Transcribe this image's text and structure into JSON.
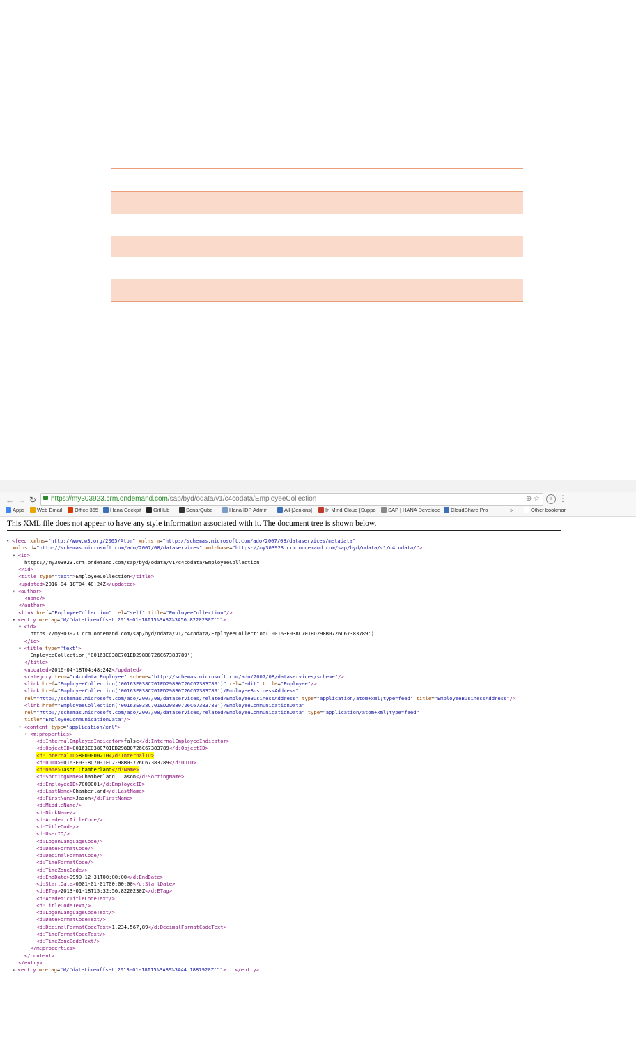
{
  "browser": {
    "url_domain": "https://my303923.crm.ondemand.com",
    "url_path": "/sap/byd/odata/v1/c4codata/EmployeeCollection",
    "bookmarks": [
      "Apps",
      "Web Email",
      "Office 365",
      "Hana Cockpit",
      "GitHub",
      "SonarQube",
      "Hana IDP Admin",
      "All [Jenkins]",
      "In Mind Cloud (Suppo",
      "SAP | HANA Develope",
      "CloudShare Pro",
      "»",
      "Other bookmar"
    ],
    "bookmark_colors": [
      "#4285f4",
      "#e8a600",
      "#d83b01",
      "#3b6fb6",
      "#222222",
      "#333333",
      "#7a9cc6",
      "#3b6fb6",
      "#c0392b",
      "#888888",
      "#3b6fb6",
      "#e8a600",
      "#ffffff",
      "#e0c070"
    ]
  },
  "notice": "This XML file does not appear to have any style information associated with it. The document tree is shown below.",
  "xml_lines": [
    "<span class='tri'>▾</span><span class='t'>&lt;feed</span> <span class='a'>xmlns</span>=<span class='v'>\"http://www.w3.org/2005/Atom\"</span> <span class='a'>xmlns:m</span>=<span class='v'>\"http://schemas.microsoft.com/ado/2007/08/dataservices/metadata\"</span>",
    "  <span class='a'>xmlns:d</span>=<span class='v'>\"http://schemas.microsoft.com/ado/2007/08/dataservices\"</span> <span class='a'>xml:base</span>=<span class='v'>\"https://my303923.crm.ondemand.com/sap/byd/odata/v1/c4codata/\"</span><span class='t'>&gt;</span>",
    "  <span class='tri'>▾</span><span class='t'>&lt;id&gt;</span>",
    "      https://my303923.crm.ondemand.com/sap/byd/odata/v1/c4codata/EmployeeCollection",
    "    <span class='t'>&lt;/id&gt;</span>",
    "    <span class='t'>&lt;title</span> <span class='a'>type</span>=<span class='v'>\"text\"</span><span class='t'>&gt;</span>EmployeeCollection<span class='t'>&lt;/title&gt;</span>",
    "    <span class='t'>&lt;updated&gt;</span>2016-04-18T04:48:24Z<span class='t'>&lt;/updated&gt;</span>",
    "  <span class='tri'>▾</span><span class='t'>&lt;author&gt;</span>",
    "      <span class='t'>&lt;name/&gt;</span>",
    "    <span class='t'>&lt;/author&gt;</span>",
    "    <span class='t'>&lt;link</span> <span class='a'>href</span>=<span class='v'>\"EmployeeCollection\"</span> <span class='a'>rel</span>=<span class='v'>\"self\"</span> <span class='a'>title</span>=<span class='v'>\"EmployeeCollection\"</span><span class='t'>/&gt;</span>",
    "  <span class='tri'>▾</span><span class='t'>&lt;entry</span> <span class='a'>m:etag</span>=<span class='v'>\"W/\"datetimeoffset'2013-01-18T15%3A32%3A56.8220230Z'\"\"</span><span class='t'>&gt;</span>",
    "    <span class='tri'>▾</span><span class='t'>&lt;id&gt;</span>",
    "        https://my303923.crm.ondemand.com/sap/byd/odata/v1/c4codata/EmployeeCollection('00163E038C701ED298B0726C67383789')",
    "      <span class='t'>&lt;/id&gt;</span>",
    "    <span class='tri'>▾</span><span class='t'>&lt;title</span> <span class='a'>type</span>=<span class='v'>\"text\"</span><span class='t'>&gt;</span>",
    "        EmployeeCollection('00163E038C701ED298B0726C67383789')",
    "      <span class='t'>&lt;/title&gt;</span>",
    "      <span class='t'>&lt;updated&gt;</span>2016-04-18T04:48:24Z<span class='t'>&lt;/updated&gt;</span>",
    "      <span class='t'>&lt;category</span> <span class='a'>term</span>=<span class='v'>\"c4codata.Employee\"</span> <span class='a'>scheme</span>=<span class='v'>\"http://schemas.microsoft.com/ado/2007/08/dataservices/scheme\"</span><span class='t'>/&gt;</span>",
    "      <span class='t'>&lt;link</span> <span class='a'>href</span>=<span class='v'>\"EmployeeCollection('00163E038C701ED298B0726C67383789')\"</span> <span class='a'>rel</span>=<span class='v'>\"edit\"</span> <span class='a'>title</span>=<span class='v'>\"Employee\"</span><span class='t'>/&gt;</span>",
    "      <span class='t'>&lt;link</span> <span class='a'>href</span>=<span class='v'>\"EmployeeCollection('00163E038C701ED298B0726C67383789')/EmployeeBusinessAddress\"</span>",
    "      <span class='a'>rel</span>=<span class='v'>\"http://schemas.microsoft.com/ado/2007/08/dataservices/related/EmployeeBusinessAddress\"</span> <span class='a'>type</span>=<span class='v'>\"application/atom+xml;type=feed\"</span> <span class='a'>title</span>=<span class='v'>\"EmployeeBusinessAddress\"</span><span class='t'>/&gt;</span>",
    "      <span class='t'>&lt;link</span> <span class='a'>href</span>=<span class='v'>\"EmployeeCollection('00163E038C701ED298B0726C67383789')/EmployeeCommunicationData\"</span>",
    "      <span class='a'>rel</span>=<span class='v'>\"http://schemas.microsoft.com/ado/2007/08/dataservices/related/EmployeeCommunicationData\"</span> <span class='a'>type</span>=<span class='v'>\"application/atom+xml;type=feed\"</span>",
    "      <span class='a'>title</span>=<span class='v'>\"EmployeeCommunicationData\"</span><span class='t'>/&gt;</span>",
    "    <span class='tri'>▾</span><span class='t'>&lt;content</span> <span class='a'>type</span>=<span class='v'>\"application/xml\"</span><span class='t'>&gt;</span>",
    "      <span class='tri'>▾</span><span class='t'>&lt;m:properties&gt;</span>",
    "          <span class='t'>&lt;d:InternalEmployeeIndicator&gt;</span>false<span class='t'>&lt;/d:InternalEmployeeIndicator&gt;</span>",
    "          <span class='t'>&lt;d:ObjectID&gt;</span>00163E038C701ED298B0726C67383789<span class='t'>&lt;/d:ObjectID&gt;</span>",
    "          <span class='hl'><span class='t'>&lt;d:InternalID&gt;</span>8000000210<span class='t'>&lt;/d:InternalID&gt;</span></span>",
    "          <span class='t'>&lt;d:UUID&gt;</span>00163E03-8C70-1ED2-98B0-726C67383789<span class='t'>&lt;/d:UUID&gt;</span>",
    "          <span class='hl'><span class='t'>&lt;d:Name&gt;</span>Jason Chamberland<span class='t'>&lt;/d:Name&gt;</span></span>",
    "          <span class='t'>&lt;d:SortingName&gt;</span>Chamberland, Jason<span class='t'>&lt;/d:SortingName&gt;</span>",
    "          <span class='t'>&lt;d:EmployeeID&gt;</span>7000001<span class='t'>&lt;/d:EmployeeID&gt;</span>",
    "          <span class='t'>&lt;d:LastName&gt;</span>Chamberland<span class='t'>&lt;/d:LastName&gt;</span>",
    "          <span class='t'>&lt;d:FirstName&gt;</span>Jason<span class='t'>&lt;/d:FirstName&gt;</span>",
    "          <span class='t'>&lt;d:MiddleName/&gt;</span>",
    "          <span class='t'>&lt;d:NickName/&gt;</span>",
    "          <span class='t'>&lt;d:AcademicTitleCode/&gt;</span>",
    "          <span class='t'>&lt;d:TitleCode/&gt;</span>",
    "          <span class='t'>&lt;d:UserID/&gt;</span>",
    "          <span class='t'>&lt;d:LogonLanguageCode/&gt;</span>",
    "          <span class='t'>&lt;d:DateFormatCode/&gt;</span>",
    "          <span class='t'>&lt;d:DecimalFormatCode/&gt;</span>",
    "          <span class='t'>&lt;d:TimeFormatCode/&gt;</span>",
    "          <span class='t'>&lt;d:TimeZoneCode/&gt;</span>",
    "          <span class='t'>&lt;d:EndDate&gt;</span>9999-12-31T00:00:00<span class='t'>&lt;/d:EndDate&gt;</span>",
    "          <span class='t'>&lt;d:StartDate&gt;</span>0001-01-01T00:00:00<span class='t'>&lt;/d:StartDate&gt;</span>",
    "          <span class='t'>&lt;d:ETag&gt;</span>2013-01-18T15:32:56.8220230Z<span class='t'>&lt;/d:ETag&gt;</span>",
    "          <span class='t'>&lt;d:AcademicTitleCodeText/&gt;</span>",
    "          <span class='t'>&lt;d:TitleCodeText/&gt;</span>",
    "          <span class='t'>&lt;d:LogonLanguageCodeText/&gt;</span>",
    "          <span class='t'>&lt;d:DateFormatCodeText/&gt;</span>",
    "          <span class='t'>&lt;d:DecimalFormatCodeText&gt;</span>1.234.567,89<span class='t'>&lt;/d:DecimalFormatCodeText&gt;</span>",
    "          <span class='t'>&lt;d:TimeFormatCodeText/&gt;</span>",
    "          <span class='t'>&lt;d:TimeZoneCodeText/&gt;</span>",
    "        <span class='t'>&lt;/m:properties&gt;</span>",
    "      <span class='t'>&lt;/content&gt;</span>",
    "    <span class='t'>&lt;/entry&gt;</span>",
    "  <span class='tri'>▸</span><span class='t'>&lt;entry</span> <span class='a'>m:etag</span>=<span class='v'>\"W/\"datetimeoffset'2013-01-18T15%3A39%3A44.1887920Z'\"\"</span><span class='t'>&gt;</span>...<span class='t'>&lt;/entry&gt;</span>"
  ]
}
